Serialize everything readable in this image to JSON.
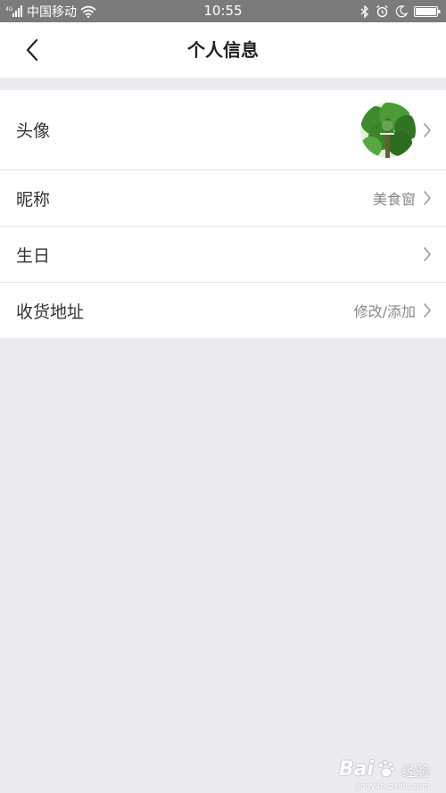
{
  "status_bar": {
    "carrier": "中国移动",
    "time": "10:55"
  },
  "nav": {
    "title": "个人信息"
  },
  "rows": [
    {
      "label": "头像",
      "value": "",
      "has_avatar": true
    },
    {
      "label": "昵称",
      "value": "美食窗"
    },
    {
      "label": "生日",
      "value": ""
    },
    {
      "label": "收货地址",
      "value": "修改/添加"
    }
  ],
  "watermark": {
    "brand_left": "Bai",
    "brand_right": "经验",
    "url": "jingyan.baidu.com"
  },
  "colors": {
    "status_bar_bg": "#7b7b7b",
    "page_bg": "#ebebf0",
    "row_bg": "#ffffff",
    "value_text": "#888888"
  },
  "icons": {
    "back": "chevron-left-icon",
    "row_arrow": "chevron-right-icon",
    "signal": "signal-icon",
    "wifi": "wifi-icon",
    "bluetooth": "bluetooth-icon",
    "alarm": "alarm-icon",
    "do_not_disturb": "moon-icon",
    "battery": "battery-icon"
  }
}
